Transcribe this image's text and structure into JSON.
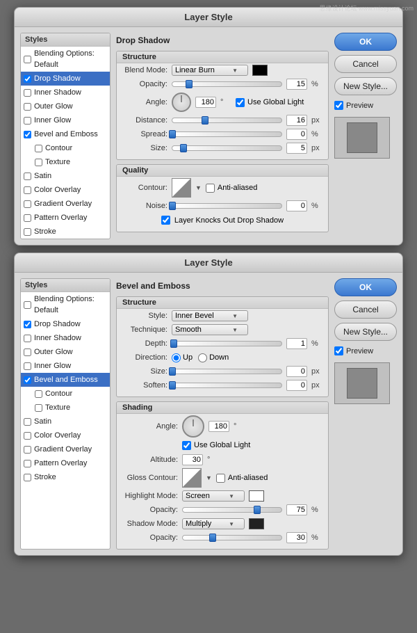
{
  "dialog1": {
    "title": "Layer Style",
    "styles": {
      "header": "Styles",
      "items": [
        {
          "label": "Blending Options: Default",
          "checked": false,
          "active": false,
          "sub": false
        },
        {
          "label": "Drop Shadow",
          "checked": true,
          "active": true,
          "sub": false
        },
        {
          "label": "Inner Shadow",
          "checked": false,
          "active": false,
          "sub": false
        },
        {
          "label": "Outer Glow",
          "checked": false,
          "active": false,
          "sub": false
        },
        {
          "label": "Inner Glow",
          "checked": false,
          "active": false,
          "sub": false
        },
        {
          "label": "Bevel and Emboss",
          "checked": true,
          "active": false,
          "sub": false
        },
        {
          "label": "Contour",
          "checked": false,
          "active": false,
          "sub": true
        },
        {
          "label": "Texture",
          "checked": false,
          "active": false,
          "sub": true
        },
        {
          "label": "Satin",
          "checked": false,
          "active": false,
          "sub": false
        },
        {
          "label": "Color Overlay",
          "checked": false,
          "active": false,
          "sub": false
        },
        {
          "label": "Gradient Overlay",
          "checked": false,
          "active": false,
          "sub": false
        },
        {
          "label": "Pattern Overlay",
          "checked": false,
          "active": false,
          "sub": false
        },
        {
          "label": "Stroke",
          "checked": false,
          "active": false,
          "sub": false
        }
      ]
    },
    "buttons": {
      "ok": "OK",
      "cancel": "Cancel",
      "new_style": "New Style...",
      "preview_label": "Preview"
    },
    "dropshadow": {
      "section_header": "Drop Shadow",
      "structure_title": "Structure",
      "blend_mode_label": "Blend Mode:",
      "blend_mode_value": "Linear Burn",
      "opacity_label": "Opacity:",
      "opacity_value": "15",
      "opacity_unit": "%",
      "opacity_slider_pct": 15,
      "angle_label": "Angle:",
      "angle_value": "180",
      "angle_unit": "°",
      "use_global_light_label": "Use Global Light",
      "use_global_light_checked": true,
      "distance_label": "Distance:",
      "distance_value": "16",
      "distance_unit": "px",
      "distance_slider_pct": 30,
      "spread_label": "Spread:",
      "spread_value": "0",
      "spread_unit": "%",
      "spread_slider_pct": 0,
      "size_label": "Size:",
      "size_value": "5",
      "size_unit": "px",
      "size_slider_pct": 10,
      "quality_title": "Quality",
      "contour_label": "Contour:",
      "anti_aliased_label": "Anti-aliased",
      "anti_aliased_checked": false,
      "noise_label": "Noise:",
      "noise_value": "0",
      "noise_unit": "%",
      "noise_slider_pct": 0,
      "layer_knocks_label": "Layer Knocks Out Drop Shadow",
      "layer_knocks_checked": true
    }
  },
  "dialog2": {
    "title": "Layer Style",
    "styles": {
      "header": "Styles",
      "items": [
        {
          "label": "Blending Options: Default",
          "checked": false,
          "active": false,
          "sub": false
        },
        {
          "label": "Drop Shadow",
          "checked": true,
          "active": false,
          "sub": false
        },
        {
          "label": "Inner Shadow",
          "checked": false,
          "active": false,
          "sub": false
        },
        {
          "label": "Outer Glow",
          "checked": false,
          "active": false,
          "sub": false
        },
        {
          "label": "Inner Glow",
          "checked": false,
          "active": false,
          "sub": false
        },
        {
          "label": "Bevel and Emboss",
          "checked": true,
          "active": true,
          "sub": false
        },
        {
          "label": "Contour",
          "checked": false,
          "active": false,
          "sub": true
        },
        {
          "label": "Texture",
          "checked": false,
          "active": false,
          "sub": true
        },
        {
          "label": "Satin",
          "checked": false,
          "active": false,
          "sub": false
        },
        {
          "label": "Color Overlay",
          "checked": false,
          "active": false,
          "sub": false
        },
        {
          "label": "Gradient Overlay",
          "checked": false,
          "active": false,
          "sub": false
        },
        {
          "label": "Pattern Overlay",
          "checked": false,
          "active": false,
          "sub": false
        },
        {
          "label": "Stroke",
          "checked": false,
          "active": false,
          "sub": false
        }
      ]
    },
    "buttons": {
      "ok": "OK",
      "cancel": "Cancel",
      "new_style": "New Style...",
      "preview_label": "Preview"
    },
    "bevel": {
      "section_header": "Bevel and Emboss",
      "structure_title": "Structure",
      "style_label": "Style:",
      "style_value": "Inner Bevel",
      "technique_label": "Technique:",
      "technique_value": "Smooth",
      "depth_label": "Depth:",
      "depth_value": "1",
      "depth_unit": "%",
      "depth_slider_pct": 1,
      "direction_label": "Direction:",
      "direction_up": "Up",
      "direction_down": "Down",
      "direction_selected": "up",
      "size_label": "Size:",
      "size_value": "0",
      "size_unit": "px",
      "size_slider_pct": 0,
      "soften_label": "Soften:",
      "soften_value": "0",
      "soften_unit": "px",
      "soften_slider_pct": 0,
      "shading_title": "Shading",
      "angle_label": "Angle:",
      "angle_value": "180",
      "angle_unit": "°",
      "use_global_light_label": "Use Global Light",
      "use_global_light_checked": true,
      "altitude_label": "Altitude:",
      "altitude_value": "30",
      "altitude_unit": "°",
      "gloss_contour_label": "Gloss Contour:",
      "anti_aliased_label": "Anti-aliased",
      "anti_aliased_checked": false,
      "highlight_mode_label": "Highlight Mode:",
      "highlight_mode_value": "Screen",
      "highlight_opacity_label": "Opacity:",
      "highlight_opacity_value": "75",
      "highlight_opacity_unit": "%",
      "highlight_opacity_slider_pct": 75,
      "shadow_mode_label": "Shadow Mode:",
      "shadow_mode_value": "Multiply",
      "shadow_opacity_label": "Opacity:",
      "shadow_opacity_value": "30",
      "shadow_opacity_unit": "%",
      "shadow_opacity_slider_pct": 30
    }
  }
}
